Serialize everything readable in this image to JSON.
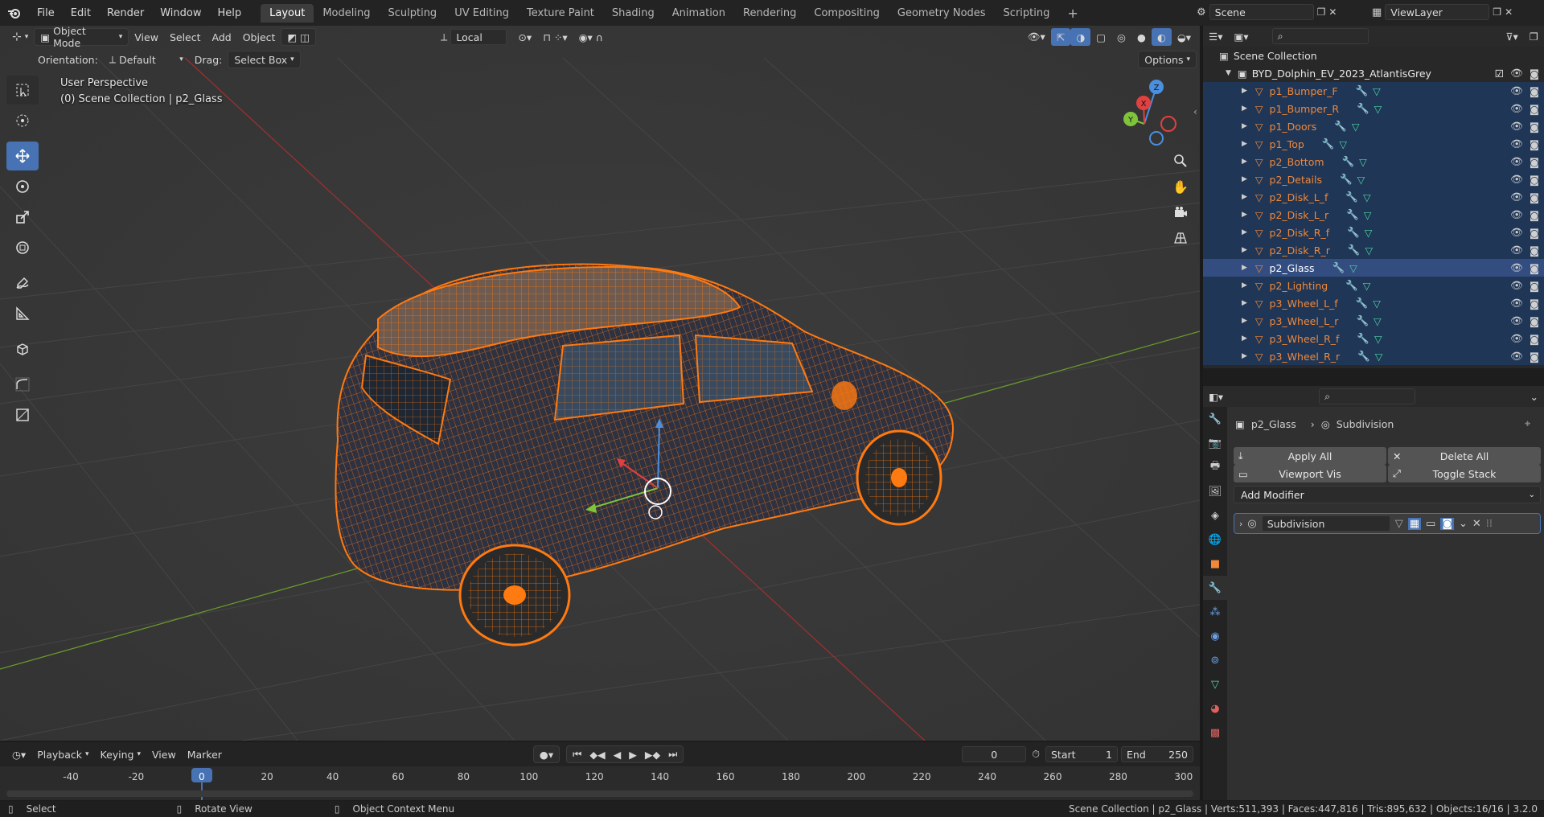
{
  "topbar": {
    "menus": [
      "File",
      "Edit",
      "Render",
      "Window",
      "Help"
    ],
    "workspaces": [
      "Layout",
      "Modeling",
      "Sculpting",
      "UV Editing",
      "Texture Paint",
      "Shading",
      "Animation",
      "Rendering",
      "Compositing",
      "Geometry Nodes",
      "Scripting"
    ],
    "active_workspace": "Layout",
    "scene": "Scene",
    "view_layer": "ViewLayer"
  },
  "viewport": {
    "mode": "Object Mode",
    "menus": [
      "View",
      "Select",
      "Add",
      "Object"
    ],
    "transform_orientation": "Local",
    "orientation_label": "Orientation:",
    "orientation_value": "Default",
    "drag_label": "Drag:",
    "drag_value": "Select Box",
    "options_label": "Options",
    "overlay_title": "User Perspective",
    "overlay_subtitle": "(0) Scene Collection | p2_Glass",
    "gizmo": {
      "x": "X",
      "y": "Y",
      "z": "Z"
    }
  },
  "outliner": {
    "root": "Scene Collection",
    "collection": "BYD_Dolphin_EV_2023_AtlantisGrey",
    "objects": [
      "p1_Bumper_F",
      "p1_Bumper_R",
      "p1_Doors",
      "p1_Top",
      "p2_Bottom",
      "p2_Details",
      "p2_Disk_L_f",
      "p2_Disk_L_r",
      "p2_Disk_R_f",
      "p2_Disk_R_r",
      "p2_Glass",
      "p2_Lighting",
      "p3_Wheel_L_f",
      "p3_Wheel_L_r",
      "p3_Wheel_R_f",
      "p3_Wheel_R_r"
    ],
    "selected": "p2_Glass"
  },
  "properties": {
    "breadcrumb_object": "p2_Glass",
    "breadcrumb_modifier": "Subdivision",
    "apply_all": "Apply All",
    "delete_all": "Delete All",
    "viewport_vis": "Viewport Vis",
    "toggle_stack": "Toggle Stack",
    "add_modifier": "Add Modifier",
    "modifier_name": "Subdivision"
  },
  "timeline": {
    "menus": [
      "Playback",
      "Keying",
      "View",
      "Marker"
    ],
    "current_frame": "0",
    "start_label": "Start",
    "start_value": "1",
    "end_label": "End",
    "end_value": "250",
    "ruler": [
      "-40",
      "-20",
      "0",
      "20",
      "40",
      "60",
      "80",
      "100",
      "120",
      "140",
      "160",
      "180",
      "200",
      "220",
      "240",
      "260",
      "280",
      "300"
    ]
  },
  "statusbar": {
    "select": "Select",
    "rotate": "Rotate View",
    "context": "Object Context Menu",
    "stats": "Scene Collection | p2_Glass | Verts:511,393 | Faces:447,816 | Tris:895,632 | Objects:16/16 | 3.2.0"
  },
  "colors": {
    "selected_orange": "#f0883a",
    "accent_blue": "#4772b3",
    "x_axis": "#c0392b",
    "y_axis": "#6a9a2a"
  }
}
